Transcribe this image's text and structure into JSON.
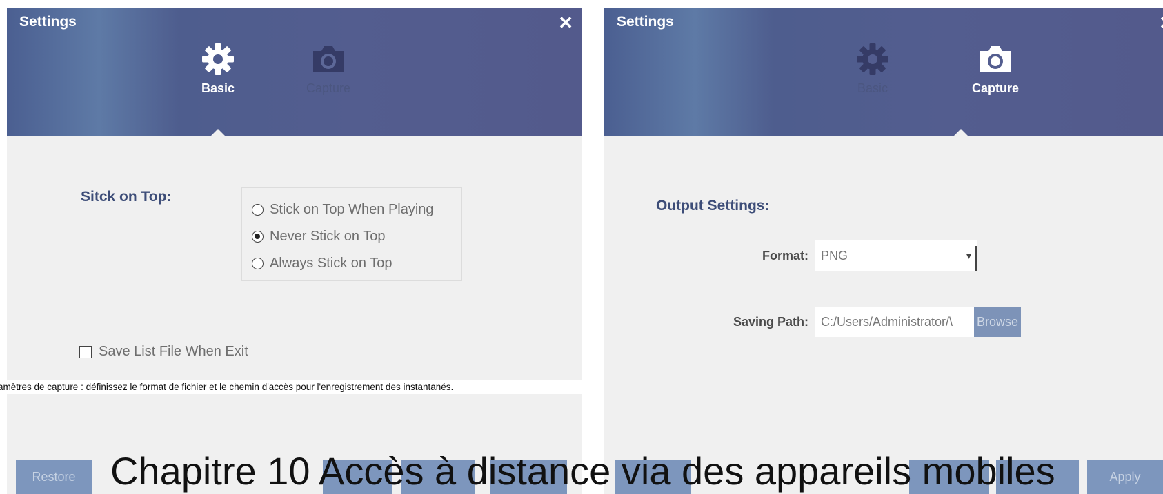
{
  "basic_dialog": {
    "title": "Settings",
    "close_symbol": "✕",
    "tabs": [
      {
        "label": "Basic",
        "icon": "gear-icon",
        "active": true
      },
      {
        "label": "Capture",
        "icon": "camera-icon",
        "active": false
      }
    ],
    "stick_on_top": {
      "label": "Sitck on Top:",
      "options": [
        {
          "label": "Stick on Top When Playing",
          "checked": false
        },
        {
          "label": "Never Stick on Top",
          "checked": true
        },
        {
          "label": "Always Stick on Top",
          "checked": false
        }
      ]
    },
    "save_list": {
      "label": "Save List File When Exit",
      "checked": false
    },
    "buttons": {
      "restore": "Restore"
    }
  },
  "capture_dialog": {
    "title": "Settings",
    "close_symbol": "✕",
    "tabs": [
      {
        "label": "Basic",
        "icon": "gear-icon",
        "active": false
      },
      {
        "label": "Capture",
        "icon": "camera-icon",
        "active": true
      }
    ],
    "output_settings_label": "Output Settings:",
    "format": {
      "label": "Format:",
      "value": "PNG"
    },
    "saving_path": {
      "label": "Saving Path:",
      "value": "C:/Users/Administrator/\\",
      "browse_label": "Browse"
    },
    "buttons": {
      "apply": "Apply"
    }
  },
  "caption": "Paramètres de capture : définissez le format de fichier et le chemin d'accès pour l'enregistrement des instantanés.",
  "chapter_title": "Chapitre 10 Accès à distance via des appareils mobiles",
  "colors": {
    "header": "#535d8f",
    "button": "#7d96bd",
    "label_blue": "#3d4d78",
    "panel": "#f0f0f0"
  }
}
